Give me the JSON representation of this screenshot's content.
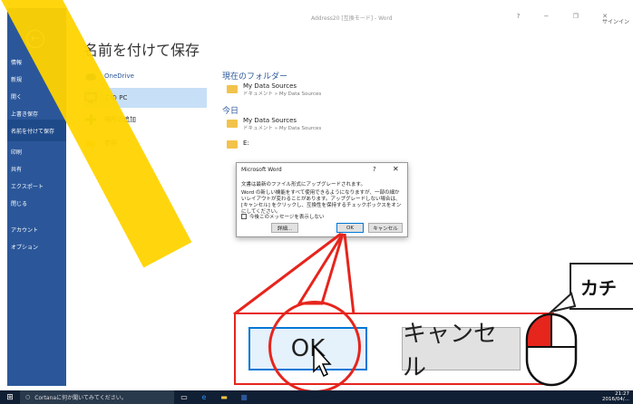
{
  "window": {
    "title": "Address20 [互換モード] - Word",
    "controls": "? − ❐ ✕",
    "signin": "サインイン"
  },
  "sidebar": {
    "back_icon": "back-arrow-icon",
    "items": [
      {
        "label": "情報"
      },
      {
        "label": "新規"
      },
      {
        "label": "開く"
      },
      {
        "label": "上書き保存"
      },
      {
        "label": "名前を付けて保存"
      },
      {
        "label": "印刷"
      },
      {
        "label": "共有"
      },
      {
        "label": "エクスポート"
      },
      {
        "label": "閉じる"
      },
      {
        "label": "アカウント"
      },
      {
        "label": "オプション"
      }
    ]
  },
  "main": {
    "heading": "名前を付けて保存",
    "locations": [
      {
        "label": "OneDrive",
        "icon": "cloud-icon"
      },
      {
        "label": "この PC",
        "icon": "computer-icon"
      },
      {
        "label": "場所の追加",
        "icon": "plus-icon"
      },
      {
        "label": "参照",
        "icon": "folder-open-icon"
      }
    ],
    "current_folder_heading": "現在のフォルダー",
    "current_folder": {
      "name": "My Data Sources",
      "path": "ドキュメント » My Data Sources"
    },
    "today_heading": "今日",
    "today": [
      {
        "name": "My Data Sources",
        "path": "ドキュメント » My Data Sources"
      },
      {
        "name": "E:",
        "path": ""
      }
    ]
  },
  "dialog": {
    "title": "Microsoft Word",
    "help": "?",
    "close": "✕",
    "message1": "文書は最新のファイル形式にアップグレードされます。",
    "message2": "Word の新しい機能をすべて使用できるようになりますが、一部の細かいレイアウトが変わることがあります。アップグレードしない場合は、[キャンセル] をクリックし、互換性を保持するチェックボックスをオンにしてください。",
    "checkbox_label": "今後このメッセージを表示しない",
    "details_button": "詳細...",
    "ok_button": "OK",
    "cancel_button": "キャンセル"
  },
  "zoom": {
    "ok_label": "OK",
    "cancel_label": "キャンセル"
  },
  "callout": {
    "text": "カチ"
  },
  "taskbar": {
    "cortana_placeholder": "Cortanaに何か聞いてみてください。",
    "time": "21:27",
    "date": "2016/04/..."
  },
  "colors": {
    "word_blue": "#2b579a",
    "highlight": "#e6251d",
    "accent_yellow": "#ffd400"
  }
}
